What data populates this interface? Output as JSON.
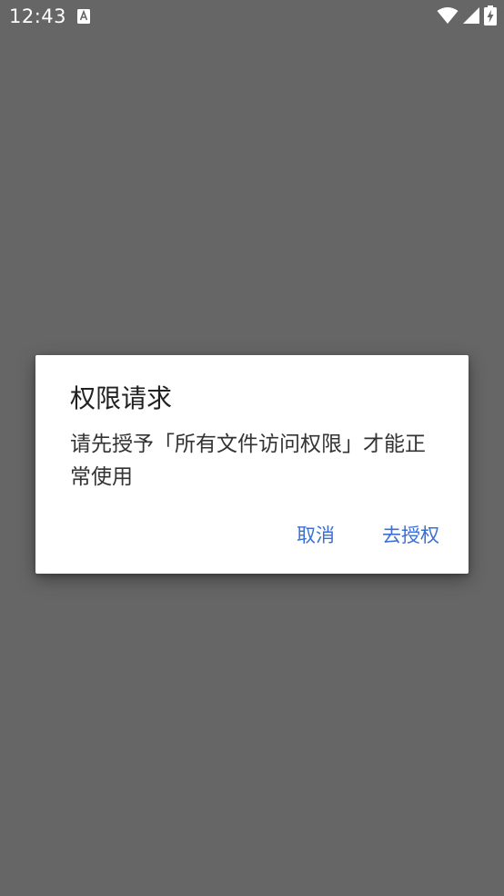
{
  "status_bar": {
    "time": "12:43",
    "notification_icon": "text-a-icon",
    "icons": [
      "wifi-icon",
      "cellular-signal-icon",
      "battery-charging-icon"
    ]
  },
  "colors": {
    "scrim": "#666666",
    "dialog_bg": "#ffffff",
    "accent": "#3b6fd4",
    "title_text": "#212121",
    "body_text": "#333333"
  },
  "dialog": {
    "title": "权限请求",
    "message": "请先授予「所有文件访问权限」才能正常使用",
    "cancel_label": "取消",
    "confirm_label": "去授权"
  }
}
